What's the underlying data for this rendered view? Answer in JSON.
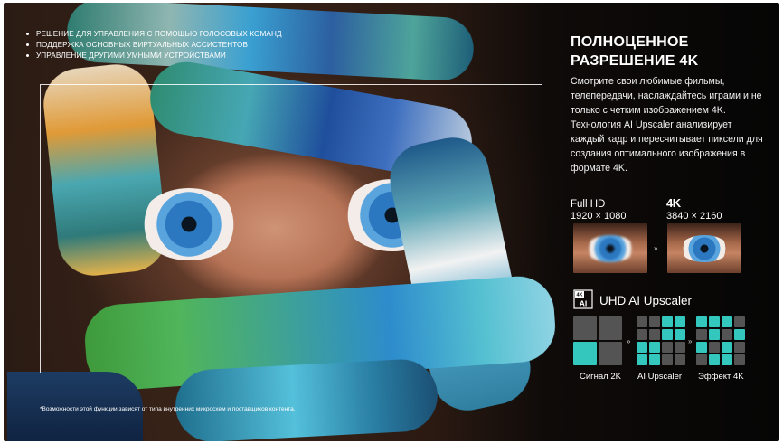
{
  "features": [
    "РЕШЕНИЕ ДЛЯ УПРАВЛЕНИЯ С ПОМОЩЬЮ ГОЛОСОВЫХ КОМАНД",
    "ПОДДЕРЖКА ОСНОВНЫХ ВИРТУАЛЬНЫХ АССИСТЕНТОВ",
    "УПРАВЛЕНИЕ ДРУГИМИ УМНЫМИ УСТРОЙСТВАМИ"
  ],
  "headline": {
    "line1": "ПОЛНОЦЕННОЕ",
    "line2": "РАЗРЕШЕНИЕ 4K"
  },
  "description": "Смотрите свои любимые фильмы, телепередачи, наслаждайтесь играми и не только с четким изображением 4K. Технология AI Upscaler анализирует каждый кадр и пересчитывает пиксели для создания оптимального изображения в формате 4K.",
  "comparison": {
    "left_label": "Full HD",
    "left_resolution": "1920 × 1080",
    "right_label": "4K",
    "right_resolution": "3840 × 2160",
    "arrow": "»"
  },
  "upscaler": {
    "icon": "ai-chip-icon",
    "icon_text": "AI",
    "icon_badge": "4K",
    "title": "UHD AI Upscaler",
    "steps": [
      "Сигнал 2K",
      "AI Upscaler",
      "Эффект 4K"
    ],
    "arrow": "»",
    "colors": {
      "accent": "#33c7bd",
      "inactive": "#545454"
    }
  },
  "footnote": "*Возможности этой функции зависят от типа внутренних микросхем и поставщиков контента."
}
